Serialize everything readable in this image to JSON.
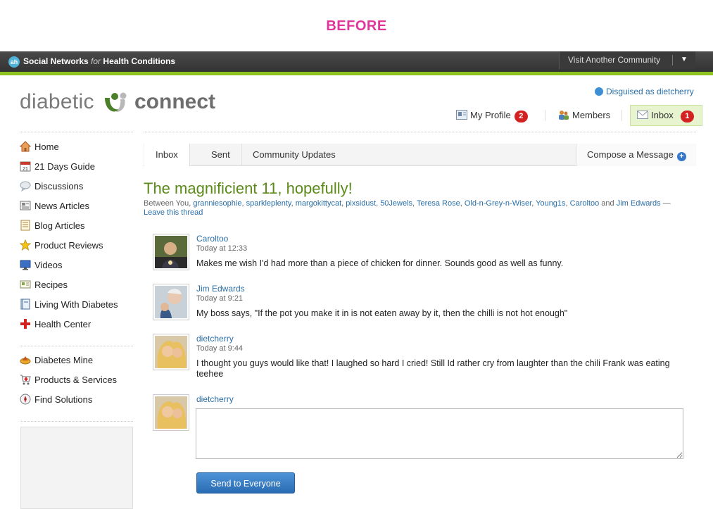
{
  "banner": {
    "label": "BEFORE"
  },
  "topbar": {
    "logo_text": "ah",
    "network_prefix": "Social Networks",
    "network_for": "for",
    "network_suffix": "Health Conditions",
    "visit_label": "Visit Another Community",
    "visit_arrow": "▼"
  },
  "site": {
    "logo_left": "diabetic",
    "logo_right": "connect"
  },
  "header": {
    "disguised_label": "Disguised as dietcherry",
    "my_profile": "My Profile",
    "my_profile_count": "2",
    "members": "Members",
    "inbox": "Inbox",
    "inbox_count": "1"
  },
  "sidebar": {
    "items": [
      {
        "label": "Home",
        "icon": "home-icon"
      },
      {
        "label": "21 Days Guide",
        "icon": "calendar-icon"
      },
      {
        "label": "Discussions",
        "icon": "speech-bubble-icon"
      },
      {
        "label": "News Articles",
        "icon": "newspaper-icon"
      },
      {
        "label": "Blog Articles",
        "icon": "blog-icon"
      },
      {
        "label": "Product Reviews",
        "icon": "star-icon"
      },
      {
        "label": "Videos",
        "icon": "monitor-icon"
      },
      {
        "label": "Recipes",
        "icon": "recipe-card-icon"
      },
      {
        "label": "Living With Diabetes",
        "icon": "book-icon"
      },
      {
        "label": "Health Center",
        "icon": "red-cross-icon"
      }
    ],
    "secondary": [
      {
        "label": "Diabetes Mine",
        "icon": "mine-icon"
      },
      {
        "label": "Products & Services",
        "icon": "cart-icon"
      },
      {
        "label": "Find Solutions",
        "icon": "compass-icon"
      }
    ]
  },
  "tabs": {
    "inbox": "Inbox",
    "sent": "Sent",
    "updates": "Community Updates",
    "compose": "Compose a Message",
    "compose_plus": "+"
  },
  "thread": {
    "title": "The magnificient 11, hopefully!",
    "between_prefix": "Between You, ",
    "participants": [
      "granniesophie",
      "sparkleplenty",
      "margokittycat",
      "pixsidust",
      "50Jewels",
      "Teresa Rose",
      "Old-n-Grey-n-Wiser",
      "Young1s",
      "Caroltoo"
    ],
    "and_word": " and ",
    "last_participant": "Jim Edwards",
    "leave_sep": " — ",
    "leave_label": "Leave this thread"
  },
  "messages": [
    {
      "author": "Caroltoo",
      "time": "Today at 12:33",
      "text": "Makes me wish I'd had more than a piece of chicken for dinner. Sounds good as well as funny."
    },
    {
      "author": "Jim Edwards",
      "time": "Today at 9:21",
      "text": "My boss says, \"If the pot you make it in is not eaten away by it, then the chilli is not hot enough\""
    },
    {
      "author": "dietcherry",
      "time": "Today at 9:44",
      "text": "I thought you guys would like that! I laughed so hard I cried! Still Id rather cry from laughter than the chili Frank was eating teehee"
    }
  ],
  "reply": {
    "author": "dietcherry",
    "value": "",
    "send_label": "Send to Everyone"
  },
  "colors": {
    "accent_green": "#8dc21f",
    "title_green": "#5a8a17",
    "link_blue": "#2a6ea6",
    "badge_red": "#d32222"
  }
}
